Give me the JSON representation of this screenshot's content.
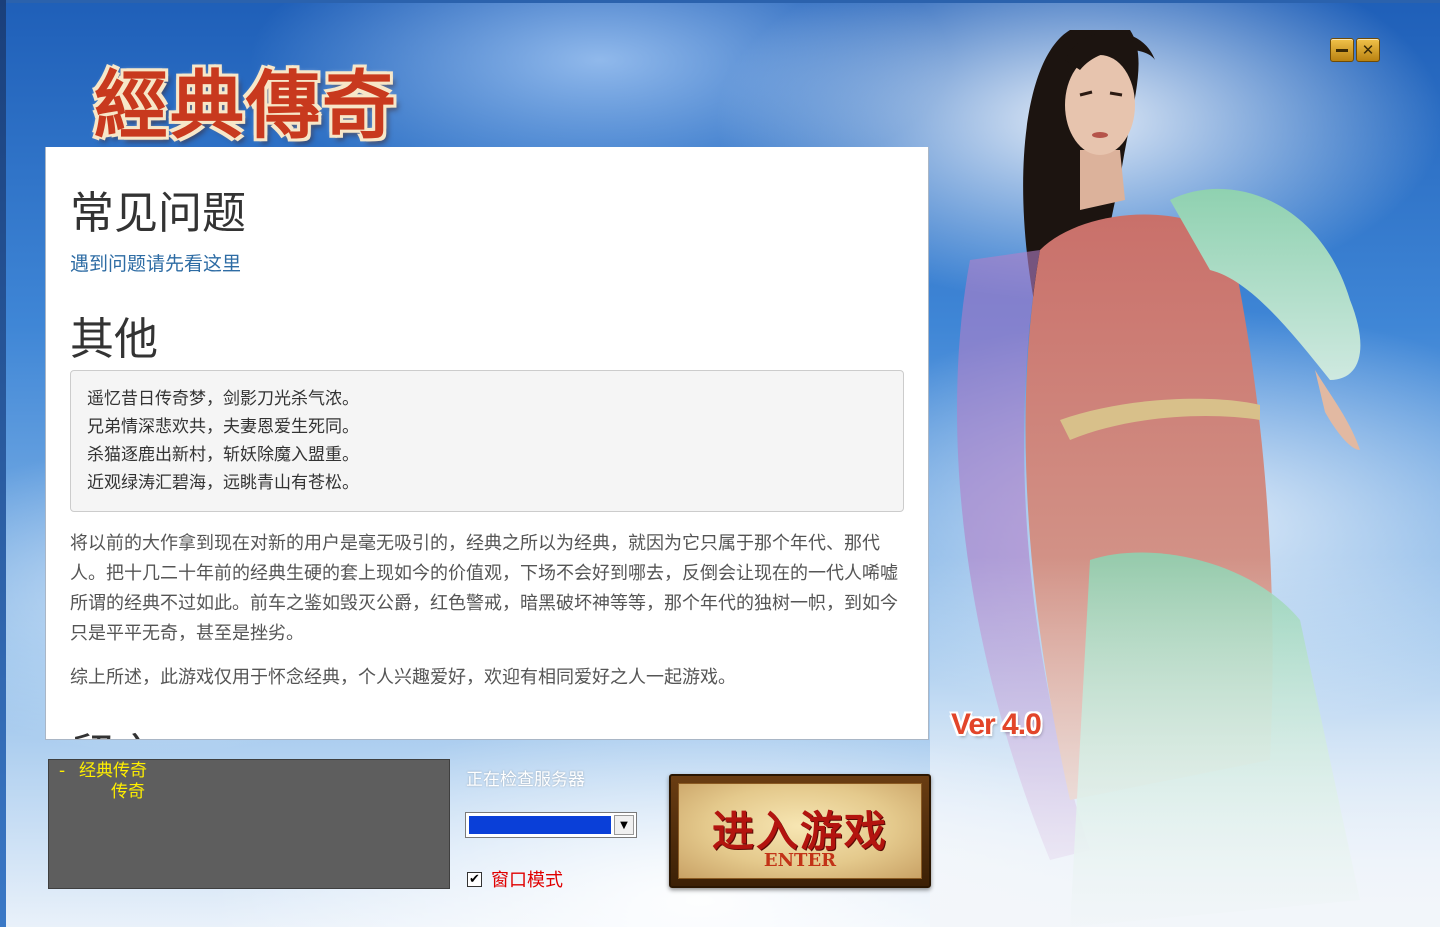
{
  "window": {
    "title_logo": "經典傳奇",
    "minimize_icon": "minimize-icon",
    "close_icon": "close-icon",
    "accent_color": "#c8391e"
  },
  "faq": {
    "heading": "常见问题",
    "link_text": "遇到问题请先看这里"
  },
  "other": {
    "heading": "其他",
    "poem_lines": [
      "遥忆昔日传奇梦，剑影刀光杀气浓。",
      "兄弟情深悲欢共，夫妻恩爱生死同。",
      "杀猫逐鹿出新村，斩妖除魔入盟重。",
      "近观绿涛汇碧海，远眺青山有苍松。"
    ],
    "paragraph_1": "将以前的大作拿到现在对新的用户是毫无吸引的，经典之所以为经典，就因为它只属于那个年代、那代人。把十几二十年前的经典生硬的套上现如今的价值观，下场不会好到哪去，反倒会让现在的一代人唏嘘所谓的经典不过如此。前车之鉴如毁灭公爵，红色警戒，暗黑破坏神等等，那个年代的独树一帜，到如今只是平平无奇，甚至是挫劣。",
    "paragraph_2": "综上所述，此游戏仅用于怀念经典，个人兴趣爱好，欢迎有相同爱好之人一起游戏。"
  },
  "message": {
    "heading": "留言"
  },
  "server_tree": {
    "group_toggle": "-",
    "group_label": "经典传奇",
    "child_label": "传奇"
  },
  "status": {
    "text": "正在检查服务器"
  },
  "server_select": {
    "selected_value": "",
    "arrow_icon": "chevron-down-icon"
  },
  "window_mode": {
    "label": "窗口模式",
    "checked": true,
    "check_mark": "✔"
  },
  "version": {
    "label": "Ver 4.0"
  },
  "enter_button": {
    "label": "进入游戏",
    "sublabel": "ENTER"
  }
}
